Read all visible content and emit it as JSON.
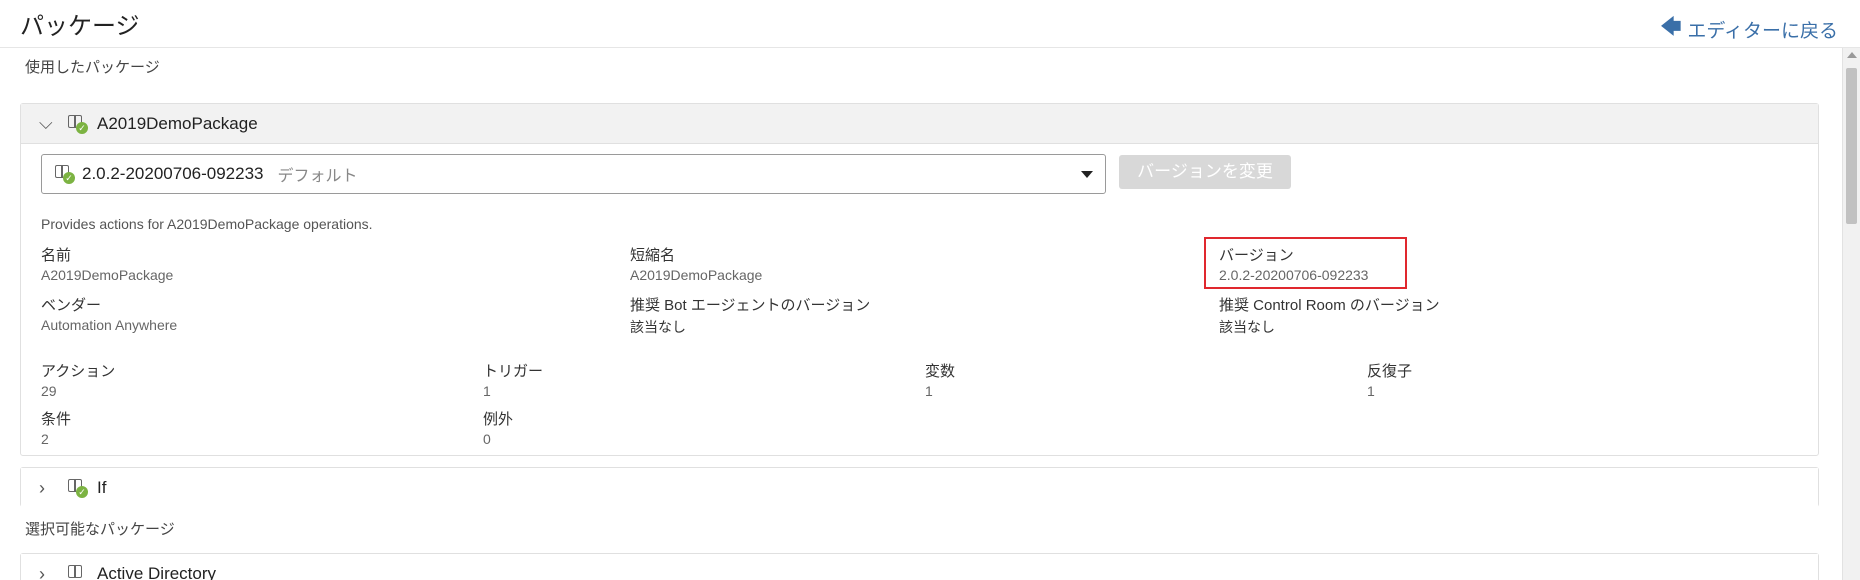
{
  "header": {
    "title": "パッケージ",
    "back_label": "エディターに戻る"
  },
  "used_packages": {
    "section_label": "使用したパッケージ",
    "expanded": {
      "name": "A2019DemoPackage",
      "selected_version": "2.0.2-20200706-092233",
      "default_tag": "デフォルト",
      "change_version_label": "バージョンを変更",
      "description": "Provides actions for A2019DemoPackage operations.",
      "details": {
        "name_label": "名前",
        "name_value": "A2019DemoPackage",
        "short_name_label": "短縮名",
        "short_name_value": "A2019DemoPackage",
        "version_label": "バージョン",
        "version_value": "2.0.2-20200706-092233",
        "vendor_label": "ベンダー",
        "vendor_value": "Automation Anywhere",
        "bot_agent_label": "推奨 Bot エージェントのバージョン",
        "bot_agent_value": "該当なし",
        "control_room_label": "推奨 Control Room のバージョン",
        "control_room_value": "該当なし"
      },
      "counts": {
        "actions_label": "アクション",
        "actions_value": "29",
        "triggers_label": "トリガー",
        "triggers_value": "1",
        "variables_label": "変数",
        "variables_value": "1",
        "iterators_label": "反復子",
        "iterators_value": "1",
        "conditions_label": "条件",
        "conditions_value": "2",
        "exceptions_label": "例外",
        "exceptions_value": "0"
      }
    },
    "collapsed": [
      {
        "name": "If"
      }
    ]
  },
  "available_packages": {
    "section_label": "選択可能なパッケージ",
    "items": [
      {
        "name": "Active Directory"
      }
    ]
  },
  "icons": {
    "back": "arrow-left-icon",
    "package": "package-icon",
    "check": "check-badge-icon"
  },
  "colors": {
    "link": "#3a6fa8",
    "check_badge": "#7cb342",
    "highlight": "#e0282e"
  }
}
